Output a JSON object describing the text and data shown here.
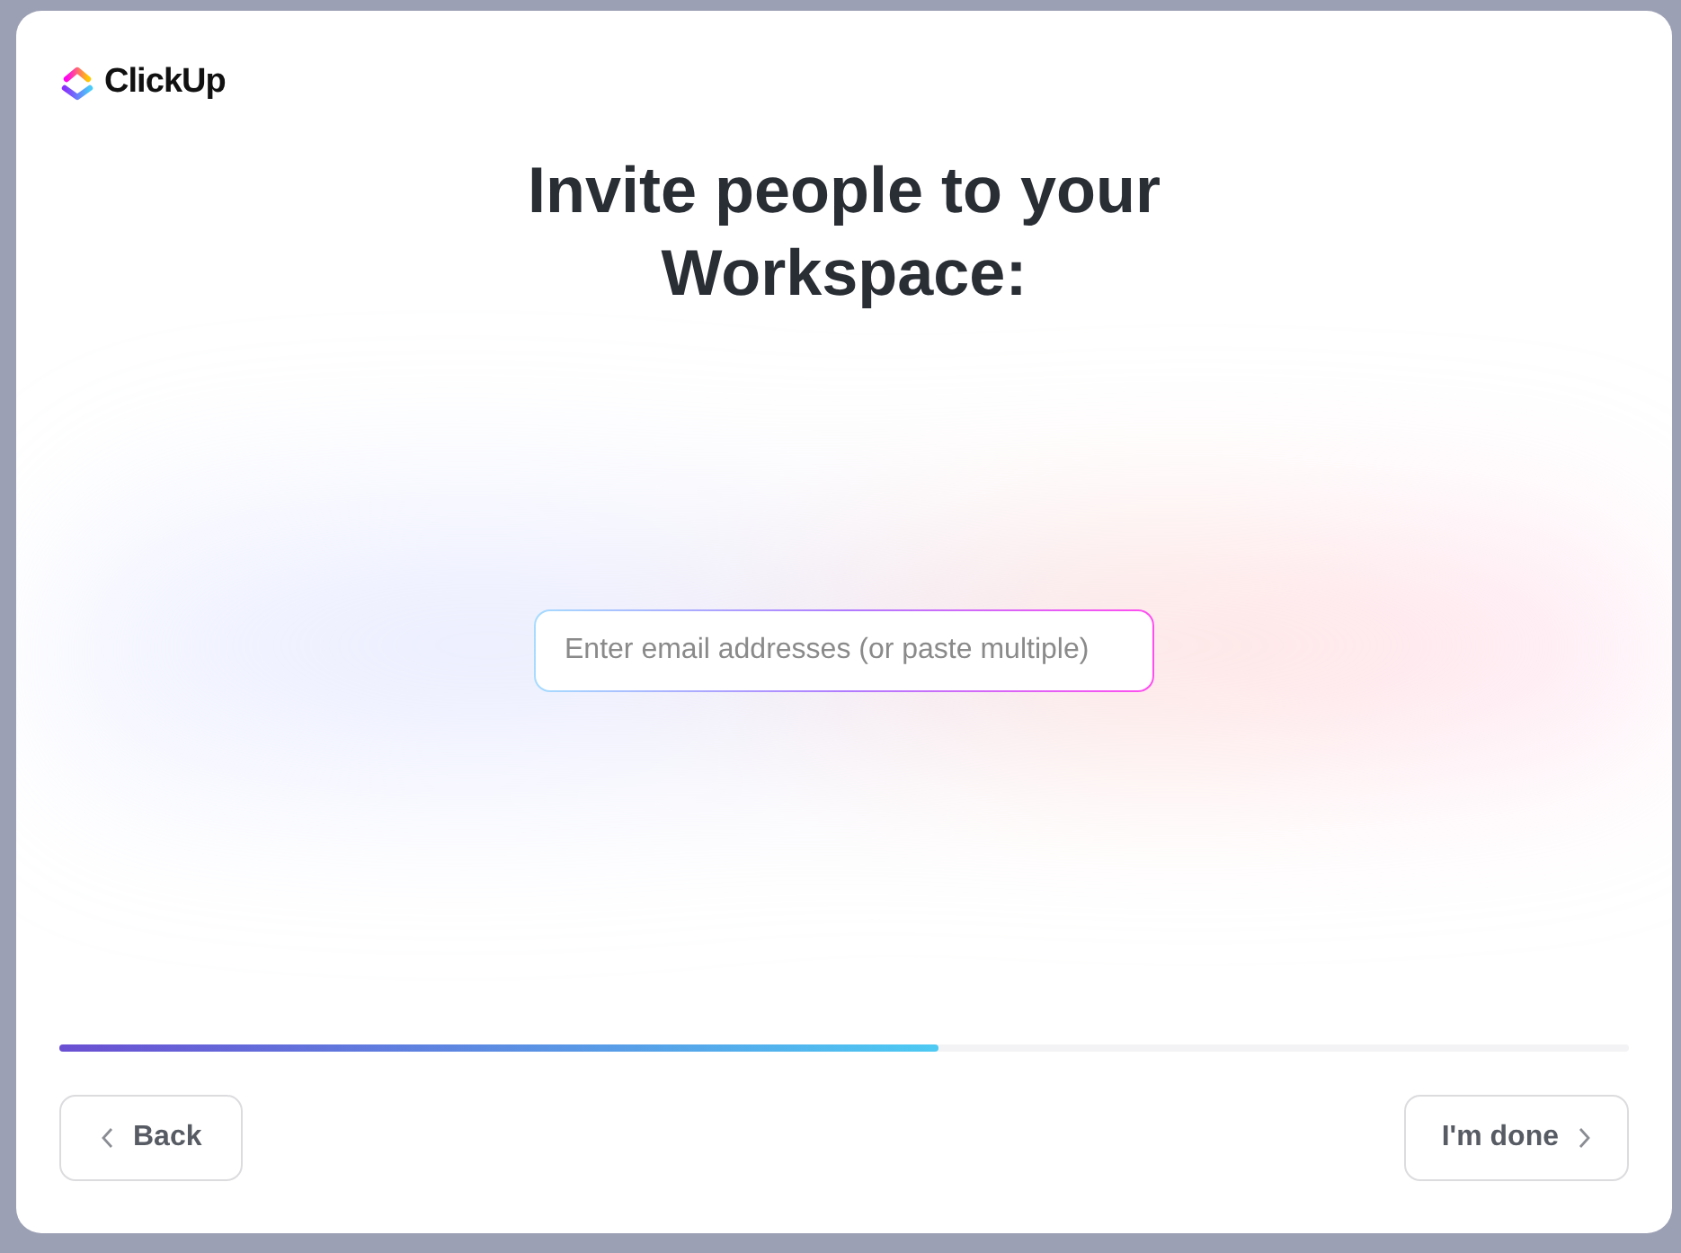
{
  "logo": {
    "text": "ClickUp"
  },
  "heading": "Invite people to your Workspace:",
  "email_field": {
    "placeholder": "Enter email addresses (or paste multiple)"
  },
  "progress": {
    "level": 0.56
  },
  "buttons": [
    {
      "kind": "back",
      "label": "Back"
    },
    {
      "kind": "next",
      "label": "I'm done"
    }
  ]
}
